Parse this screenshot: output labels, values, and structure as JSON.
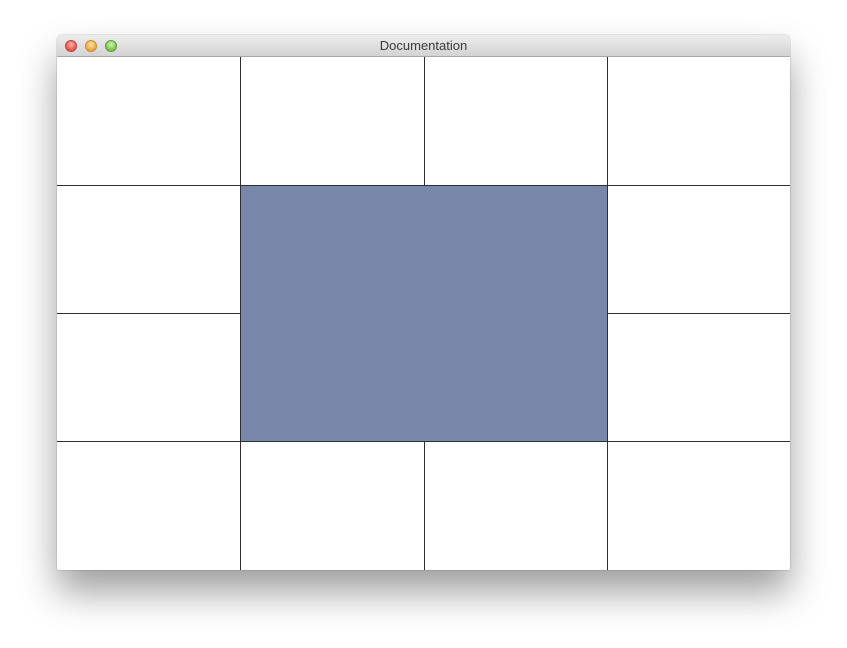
{
  "window": {
    "title": "Documentation"
  },
  "colors": {
    "center_block": "#7988aa",
    "grid_line": "#2f2f2f",
    "cell_background": "#ffffff"
  },
  "icons": {
    "close": "close-traffic-light",
    "minimize": "minimize-traffic-light",
    "zoom": "zoom-traffic-light"
  },
  "grid": {
    "rows": 4,
    "columns": 4,
    "merged_center": {
      "rows": [
        2,
        3
      ],
      "columns": [
        2,
        3
      ]
    }
  }
}
